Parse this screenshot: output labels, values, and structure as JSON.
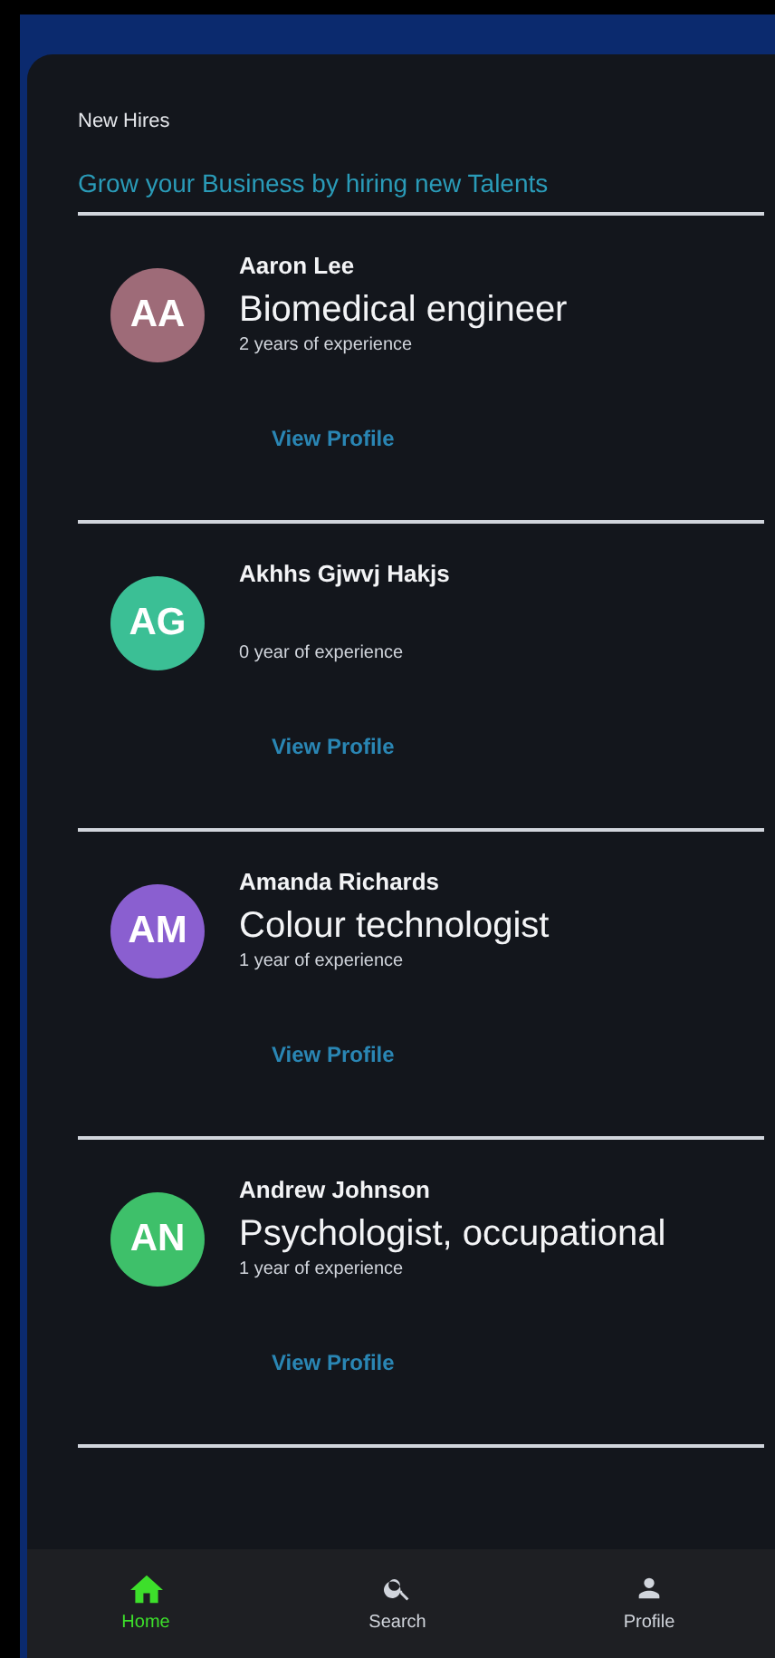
{
  "header": {
    "title": "New Hires",
    "subtitle": "Grow your Business by hiring new Talents"
  },
  "hires": [
    {
      "initials": "AA",
      "color": "#9e6b78",
      "name": "Aaron Lee",
      "title": "Biomedical engineer",
      "experience": "2 years of experience",
      "action": "View Profile"
    },
    {
      "initials": "AG",
      "color": "#3bbf95",
      "name": "Akhhs Gjwvj Hakjs",
      "experience": "0 year of experience",
      "action": "View Profile"
    },
    {
      "initials": "AM",
      "color": "#8a5fd0",
      "name": "Amanda Richards",
      "title": "Colour technologist",
      "experience": "1 year of experience",
      "action": "View Profile"
    },
    {
      "initials": "AN",
      "color": "#3ec06a",
      "name": "Andrew Johnson",
      "title": "Psychologist, occupational",
      "experience": "1 year of experience",
      "action": "View Profile"
    }
  ],
  "bottom_nav": [
    {
      "kind": "home",
      "label": "Home",
      "selected": true
    },
    {
      "kind": "search",
      "label": "Search",
      "selected": false
    },
    {
      "kind": "profile",
      "label": "Profile",
      "selected": false
    }
  ]
}
